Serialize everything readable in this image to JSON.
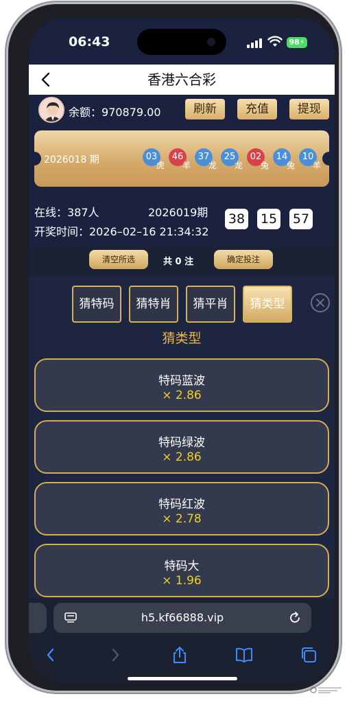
{
  "status_bar": {
    "time": "06:43",
    "battery": "98"
  },
  "nav": {
    "title": "香港六合彩"
  },
  "account": {
    "balance_label": "余额：",
    "balance_value": "970879.00",
    "buttons": [
      "刷新",
      "充值",
      "提现"
    ]
  },
  "last_draw": {
    "issue": "2026018 期",
    "balls": [
      {
        "num": "03",
        "zodiac": "虎",
        "color": "#4a8fd8"
      },
      {
        "num": "46",
        "zodiac": "羊",
        "color": "#d8434a"
      },
      {
        "num": "37",
        "zodiac": "龙",
        "color": "#4a8fd8"
      },
      {
        "num": "25",
        "zodiac": "龙",
        "color": "#4a8fd8"
      },
      {
        "num": "02",
        "zodiac": "兔",
        "color": "#d8434a"
      },
      {
        "num": "14",
        "zodiac": "兔",
        "color": "#4a8fd8"
      },
      {
        "num": "10",
        "zodiac": "羊",
        "color": "#4a8fd8"
      }
    ]
  },
  "info": {
    "online": "在线：387人",
    "next_issue": "2026019期",
    "draw_time": "开奖时间：2026–02–16 21:34:32",
    "countdown": [
      "38",
      "15",
      "57"
    ]
  },
  "bet_bar": {
    "clear_label": "清空所选",
    "count_text": "共 0 注",
    "confirm_label": "确定投注"
  },
  "tabs": [
    {
      "label": "猜特码",
      "active": false
    },
    {
      "label": "猜特肖",
      "active": false
    },
    {
      "label": "猜平肖",
      "active": false
    },
    {
      "label": "猜类型",
      "active": true
    }
  ],
  "section_title": "猜类型",
  "options": [
    {
      "name": "特码蓝波",
      "odds": "× 2.86"
    },
    {
      "name": "特码绿波",
      "odds": "× 2.86"
    },
    {
      "name": "特码红波",
      "odds": "× 2.78"
    },
    {
      "name": "特码大",
      "odds": "× 1.96"
    }
  ],
  "browser": {
    "url": "h5.kf66888.vip"
  },
  "colors": {
    "gold": "#d6b25c",
    "odds": "#f2d01e",
    "background": "#1a2240"
  }
}
